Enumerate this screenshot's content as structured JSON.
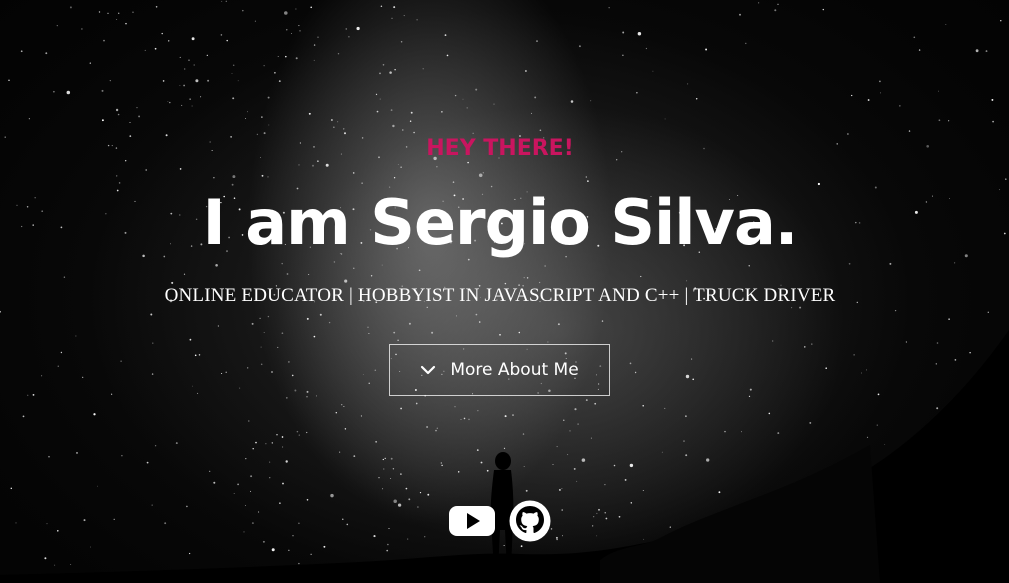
{
  "hero": {
    "eyebrow": "HEY THERE!",
    "headline": "I am Sergio Silva.",
    "subline": "ONLINE EDUCATOR | HOBBYIST IN JAVASCRIPT AND C++ | TRUCK DRIVER",
    "cta_label": "More About Me",
    "cta_icon": "chevron-down-icon"
  },
  "social": [
    {
      "name": "youtube-icon"
    },
    {
      "name": "github-icon"
    }
  ],
  "colors": {
    "accent": "#c9155f",
    "text": "#ffffff",
    "background": "#000000"
  }
}
